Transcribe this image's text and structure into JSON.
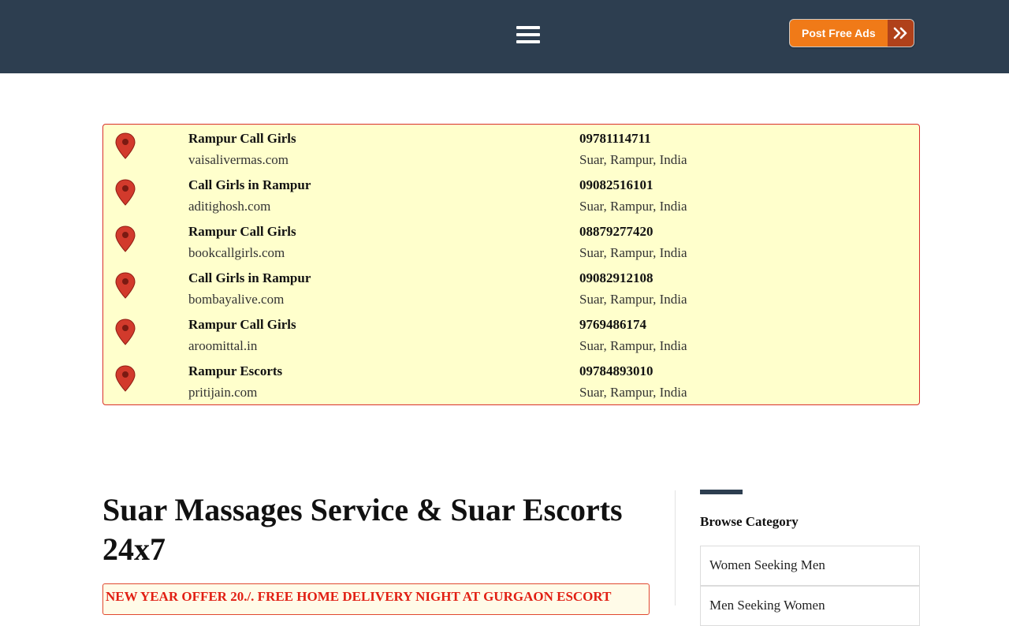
{
  "header": {
    "menu_icon": "hamburger-menu-icon",
    "post_ad_label": "Post Free Ads",
    "post_ad_icon": "double-chevron-right-icon",
    "colors": {
      "bar": "#2d3e50",
      "button": "#f07a18",
      "button_arrow": "#b0411a"
    }
  },
  "listings": [
    {
      "title": "Rampur Call Girls",
      "site": "vaisalivermas.com",
      "phone": "09781114711",
      "location": "Suar, Rampur, India"
    },
    {
      "title": "Call Girls in Rampur",
      "site": "aditighosh.com",
      "phone": "09082516101",
      "location": "Suar, Rampur, India"
    },
    {
      "title": "Rampur Call Girls",
      "site": "bookcallgirls.com",
      "phone": "08879277420",
      "location": "Suar, Rampur, India"
    },
    {
      "title": "Call Girls in Rampur",
      "site": "bombayalive.com",
      "phone": "09082912108",
      "location": "Suar, Rampur, India"
    },
    {
      "title": "Rampur Call Girls",
      "site": "aroomittal.in",
      "phone": "9769486174",
      "location": "Suar, Rampur, India"
    },
    {
      "title": "Rampur Escorts",
      "site": "pritijain.com",
      "phone": "09784893010",
      "location": "Suar, Rampur, India"
    }
  ],
  "main": {
    "title": "Suar Massages Service & Suar Escorts 24x7",
    "offer": "NEW YEAR OFFER 20./. FREE HOME DELIVERY NIGHT AT GURGAON ESCORT"
  },
  "sidebar": {
    "heading": "Browse Category",
    "categories": [
      "Women Seeking Men",
      "Men Seeking Women"
    ]
  }
}
